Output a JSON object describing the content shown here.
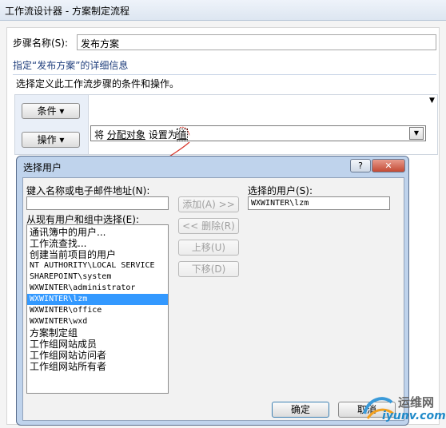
{
  "window": {
    "title": "工作流设计器 - 方案制定流程"
  },
  "step": {
    "label": "步骤名称(S):",
    "value": "发布方案"
  },
  "details": {
    "heading": "指定“发布方案”的详细信息",
    "instruction": "选择定义此工作流步骤的条件和操作。"
  },
  "conditions": {
    "button_label": "条件 ▾"
  },
  "actions": {
    "button_label": "操作 ▾",
    "sentence_prefix": "将",
    "sentence_link": "分配对象",
    "sentence_mid": "设置为",
    "sentence_value": "值"
  },
  "dialog": {
    "title": "选择用户",
    "help_label": "?",
    "close_label": "✕",
    "name_label": "键入名称或电子邮件地址(N):",
    "name_value": "",
    "existing_label": "从现有用户和组中选择(E):",
    "existing_items": [
      "通讯簿中的用户...",
      "工作流查找...",
      "创建当前项目的用户",
      "NT AUTHORITY\\LOCAL SERVICE",
      "SHAREPOINT\\system",
      "WXWINTER\\administrator",
      "WXWINTER\\lzm",
      "WXWINTER\\office",
      "WXWINTER\\wxd",
      "方案制定组",
      "工作组网站成员",
      "工作组网站访问者",
      "工作组网站所有者"
    ],
    "selected_existing": "WXWINTER\\lzm",
    "add_label": "添加(A) >>",
    "remove_label": "<< 删除(R)",
    "move_up_label": "上移(U)",
    "move_down_label": "下移(D)",
    "selected_users_label": "选择的用户(S):",
    "selected_users_value": "WXWINTER\\lzm",
    "ok_label": "确定",
    "cancel_label": "取消"
  },
  "watermark": {
    "cn": "运维网",
    "en": "iyunv.com"
  },
  "colors": {
    "selection": "#3399ff",
    "arrow": "#d8352a"
  }
}
